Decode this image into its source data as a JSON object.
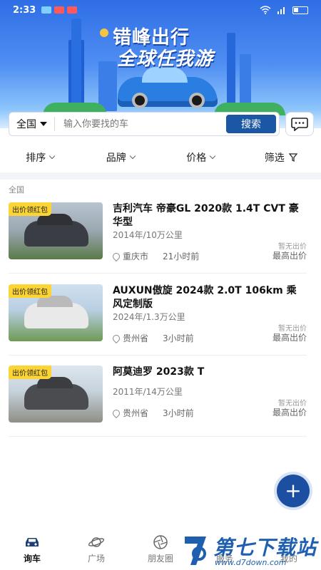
{
  "status_bar": {
    "time": "2:33"
  },
  "banner": {
    "line1": "错峰出行",
    "line2": "全球任我游"
  },
  "search": {
    "region": "全国",
    "placeholder": "输入你要找的车",
    "button_label": "搜索"
  },
  "filters": [
    {
      "label": "排序"
    },
    {
      "label": "品牌"
    },
    {
      "label": "价格"
    },
    {
      "label": "筛选"
    }
  ],
  "region_label": "全国",
  "listings": [
    {
      "tag": "出价领红包",
      "title": "吉利汽车 帝豪GL 2020款 1.4T CVT 豪华型",
      "meta": "2014年/10万公里",
      "location": "重庆市",
      "time": "21小时前",
      "price_note": "暂无出价",
      "price_label": "最高出价",
      "car_color": "#3b3d44"
    },
    {
      "tag": "出价领红包",
      "title": "AUXUN傲旋 2024款 2.0T 106km 乘风定制版",
      "meta": "2024年/1.3万公里",
      "location": "贵州省",
      "time": "3小时前",
      "price_note": "暂无出价",
      "price_label": "最高出价",
      "car_color": "#e9e9ea"
    },
    {
      "tag": "出价领红包",
      "title": "阿莫迪罗 2023款 T",
      "meta": "2011年/14万公里",
      "location": "贵州省",
      "time": "3小时前",
      "price_note": "暂无出价",
      "price_label": "最高出价",
      "car_color": "#4a4c50"
    }
  ],
  "fab": {
    "label": "+"
  },
  "bottom_nav": [
    {
      "label": "询车",
      "icon": "car-icon",
      "active": true
    },
    {
      "label": "广场",
      "icon": "planet-icon",
      "active": false
    },
    {
      "label": "朋友圈",
      "icon": "aperture-icon",
      "active": false
    },
    {
      "label": "服务",
      "icon": "service-icon",
      "active": false
    },
    {
      "label": "我的",
      "icon": "profile-icon",
      "active": false
    }
  ],
  "watermark": {
    "name": "第七下载站",
    "url": "www.d7down.com"
  },
  "colors": {
    "accent": "#1c57a6",
    "tag": "#fcd433",
    "fab": "#1c4fa1"
  }
}
